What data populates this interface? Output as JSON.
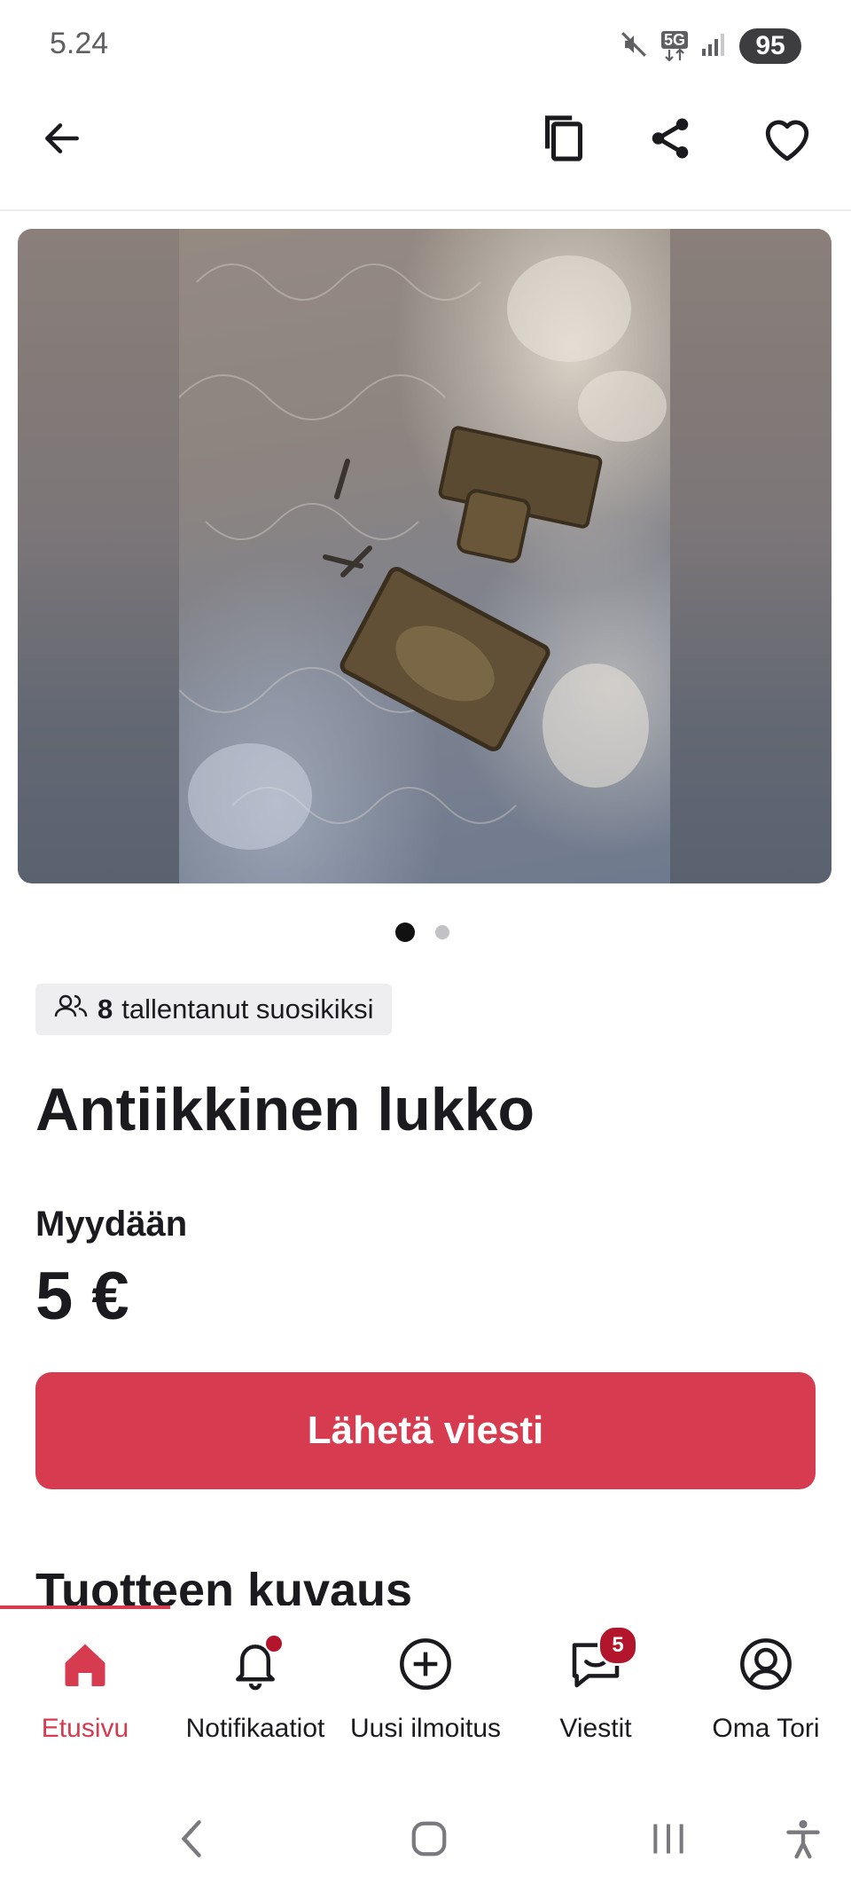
{
  "status_bar": {
    "time": "5.24",
    "network": "5G",
    "battery": "95"
  },
  "listing": {
    "favorites_count": "8",
    "favorites_text": "tallentanut suosikiksi",
    "title": "Antiikkinen lukko",
    "sale_type": "Myydään",
    "price": "5 €",
    "image_count": 2,
    "current_image": 1
  },
  "actions": {
    "send_message": "Lähetä viesti"
  },
  "sections": {
    "description_heading": "Tuotteen kuvaus"
  },
  "bottom_nav": {
    "items": [
      {
        "label": "Etusivu",
        "icon": "home-icon",
        "active": true
      },
      {
        "label": "Notifikaatiot",
        "icon": "bell-icon"
      },
      {
        "label": "Uusi ilmoitus",
        "icon": "plus-circle-icon"
      },
      {
        "label": "Viestit",
        "icon": "chat-icon",
        "badge": "5"
      },
      {
        "label": "Oma Tori",
        "icon": "profile-icon"
      }
    ]
  },
  "colors": {
    "accent": "#d63b4f",
    "badge": "#b3152c"
  }
}
